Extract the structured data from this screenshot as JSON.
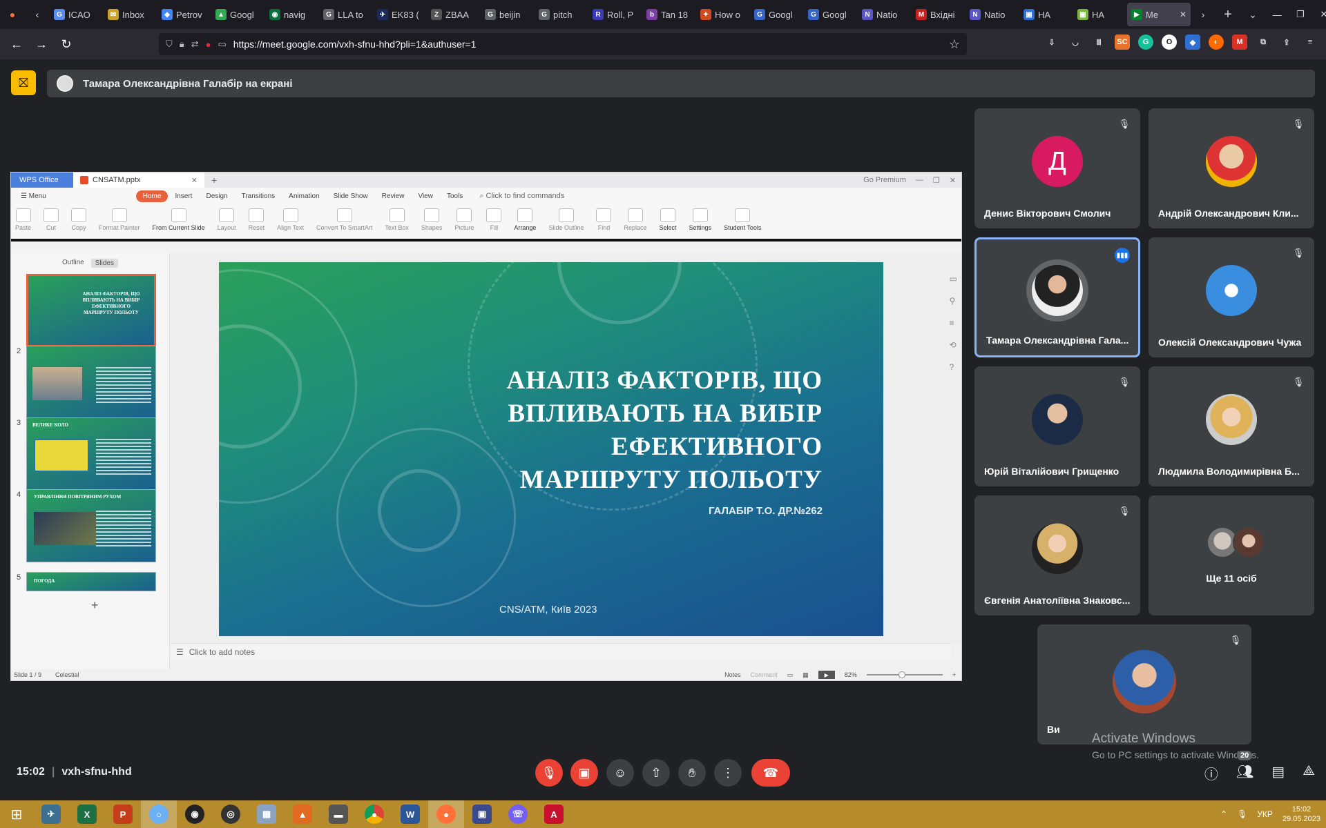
{
  "browser": {
    "tabs": [
      {
        "label": "ICAO",
        "color": "#5b8def",
        "letter": "G"
      },
      {
        "label": "Inbox",
        "color": "#c9a227",
        "letter": "✉"
      },
      {
        "label": "Petrov",
        "color": "#4285f4",
        "letter": "◆"
      },
      {
        "label": "Googl",
        "color": "#34a853",
        "letter": "▲"
      },
      {
        "label": "navig",
        "color": "#0b6e3d",
        "letter": "◉"
      },
      {
        "label": "LLA to",
        "color": "#5f6368",
        "letter": "G"
      },
      {
        "label": "EK83 (",
        "color": "#1b2a5c",
        "letter": "✈"
      },
      {
        "label": "ZBAA",
        "color": "#555555",
        "letter": "Z"
      },
      {
        "label": "beijin",
        "color": "#5f6368",
        "letter": "G"
      },
      {
        "label": "pitch",
        "color": "#5f6368",
        "letter": "G"
      },
      {
        "label": "Roll, P",
        "color": "#3b3bb3",
        "letter": "R"
      },
      {
        "label": "Tan 18",
        "color": "#7b3fa6",
        "letter": "b"
      },
      {
        "label": "How o",
        "color": "#d04a1f",
        "letter": "✦"
      },
      {
        "label": "Googl",
        "color": "#3565c9",
        "letter": "G"
      },
      {
        "label": "Googl",
        "color": "#3565c9",
        "letter": "G"
      },
      {
        "label": "Natio",
        "color": "#5a56c4",
        "letter": "N"
      },
      {
        "label": "Вхідні",
        "color": "#c5221f",
        "letter": "M"
      },
      {
        "label": "Natio",
        "color": "#5a56c4",
        "letter": "N"
      },
      {
        "label": "НА",
        "color": "#2f6fd1",
        "letter": "▣"
      },
      {
        "label": "НА",
        "color": "#7cb342",
        "letter": "▣"
      }
    ],
    "active_tab": {
      "label": "Me",
      "sub": "PLAY"
    },
    "url": "https://meet.google.com/vxh-sfnu-hhd?pli=1&authuser=1"
  },
  "meet": {
    "presenting_banner": "Тамара Олександрівна Галабір на екрані",
    "meeting_time": "15:02",
    "meeting_code": "vxh-sfnu-hhd",
    "participants_badge": "20",
    "more_people": "Ще 11 осіб",
    "participants": [
      {
        "name": "Денис Вікторович Смолич",
        "avatar_letter": "Д",
        "muted": true
      },
      {
        "name": "Андрій Олександрович Кли...",
        "muted": true
      },
      {
        "name": "Тамара Олександрівна Гала...",
        "muted": false,
        "speaking": true
      },
      {
        "name": "Олексій Олександрович Чужа",
        "muted": true
      },
      {
        "name": "Юрій Віталійович Грищенко",
        "muted": true
      },
      {
        "name": "Людмила Володимирівна Б...",
        "muted": true
      },
      {
        "name": "Євгенія Анатоліївна Знаковс...",
        "muted": true
      },
      {
        "name": "Ви",
        "muted": true
      }
    ]
  },
  "windows_notice": {
    "line1": "Activate Windows",
    "line2": "Go to PC settings to activate Windows."
  },
  "wps": {
    "brand": "WPS Office",
    "filename": "CNSATM.pptx",
    "go_premium": "Go Premium",
    "menu_label": "Menu",
    "menus": [
      "Home",
      "Insert",
      "Design",
      "Transitions",
      "Animation",
      "Slide Show",
      "Review",
      "View",
      "Tools"
    ],
    "find_placeholder": "Click to find commands",
    "ribbon": [
      "Paste",
      "Cut",
      "Copy",
      "Format Painter",
      "From Current Slide",
      "Layout",
      "Reset",
      "Align Text",
      "Convert To SmartArt",
      "Text Box",
      "Shapes",
      "Picture",
      "Fill",
      "Arrange",
      "Slide Outline",
      "Find",
      "Replace",
      "Select",
      "Settings",
      "Student Tools"
    ],
    "panel_tabs": [
      "Outline",
      "Slides"
    ],
    "thumb_numbers": [
      "2",
      "3",
      "4",
      "5"
    ],
    "thumb_titles": [
      "АНАЛІЗ ФАКТОРІВ, ЩО ВПЛИВАЮТЬ НА ВИБІР ЕФЕКТИВНОГО МАРШРУТУ ПОЛЬОТУ",
      "",
      "ВЕЛИКЕ КОЛО",
      "УПРАВЛІННЯ ПОВІТРЯНИМ РУХОМ",
      "ПОГОДА"
    ],
    "slide": {
      "title_lines": [
        "АНАЛІЗ ФАКТОРІВ, ЩО",
        "ВПЛИВАЮТЬ НА ВИБІР",
        "ЕФЕКТИВНОГО",
        "МАРШРУТУ ПОЛЬОТУ"
      ],
      "subtitle": "ГАЛАБІР Т.О. ДР.№262",
      "footer": "CNS/ATM, Київ 2023"
    },
    "notes_placeholder": "Click to add notes",
    "status": {
      "slide": "Slide 1 / 9",
      "theme": "Celestial",
      "notes": "Notes",
      "comment": "Comment",
      "zoom": "82%"
    }
  },
  "taskbar": {
    "lang": "УКР",
    "time": "15:02",
    "date": "29.05.2023"
  }
}
